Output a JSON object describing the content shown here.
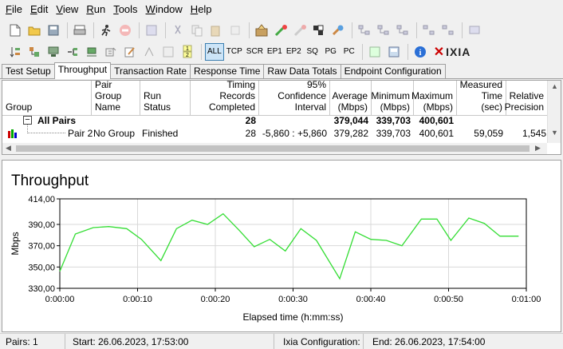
{
  "menu": [
    "File",
    "Edit",
    "View",
    "Run",
    "Tools",
    "Window",
    "Help"
  ],
  "menu_underline": [
    "F",
    "E",
    "V",
    "R",
    "T",
    "W",
    "H"
  ],
  "toolbar2_text_buttons": [
    "ALL",
    "TCP",
    "SCR",
    "EP1",
    "EP2",
    "SQ",
    "PG",
    "PC"
  ],
  "logo_text": "IXIA",
  "tabs": [
    "Test Setup",
    "Throughput",
    "Transaction Rate",
    "Response Time",
    "Raw Data Totals",
    "Endpoint Configuration"
  ],
  "active_tab": "Throughput",
  "grid": {
    "headers": {
      "group": "Group",
      "pair_group_name": "Pair Group Name",
      "run_status": "Run Status",
      "timing_records": "Timing Records Completed",
      "confidence": "95% Confidence Interval",
      "average": "Average (Mbps)",
      "minimum": "Minimum (Mbps)",
      "maximum": "Maximum (Mbps)",
      "measured_time": "Measured Time (sec)",
      "relative_precision": "Relative Precision"
    },
    "all_pairs": {
      "expander": "−",
      "label": "All Pairs",
      "timing_records": "28",
      "average": "379,044",
      "minimum": "339,703",
      "maximum": "400,601"
    },
    "pair_row": {
      "name": "Pair 2",
      "pair_group_name": "No Group",
      "run_status": "Finished",
      "timing_records": "28",
      "confidence": "-5,860 : +5,860",
      "average": "379,282",
      "minimum": "339,703",
      "maximum": "400,601",
      "measured_time": "59,059",
      "relative_precision": "1,545"
    }
  },
  "chart": {
    "title": "Throughput"
  },
  "chart_data": {
    "type": "line",
    "title": "Throughput",
    "xlabel": "Elapsed time (h:mm:ss)",
    "ylabel": "Mbps",
    "xlim": [
      0,
      60
    ],
    "ylim": [
      330,
      414
    ],
    "x_ticks": [
      "0:00:00",
      "0:00:10",
      "0:00:20",
      "0:00:30",
      "0:00:40",
      "0:00:50",
      "0:01:00"
    ],
    "y_ticks": [
      "330,00",
      "350,00",
      "370,00",
      "390,00",
      "414,00"
    ],
    "y_tick_values": [
      330,
      350,
      370,
      390,
      414
    ],
    "grid": true,
    "line_color": "#33dd33",
    "series": [
      {
        "x": [
          0,
          2,
          4.3,
          6.3,
          8.6,
          10.5,
          13,
          15,
          17,
          19,
          21,
          23,
          25,
          27,
          29,
          31,
          33,
          36,
          38,
          40,
          42,
          44,
          46.5,
          48.5,
          50.3,
          52.6,
          54.6,
          56.6,
          59
        ],
        "values": [
          346,
          381,
          387,
          388,
          386,
          376,
          356,
          386,
          394,
          390,
          400,
          385,
          369,
          376,
          365,
          386,
          375,
          339,
          383,
          376,
          375,
          370,
          395,
          395,
          375,
          396,
          391,
          379,
          379
        ]
      }
    ]
  },
  "status": {
    "pairs": "Pairs: 1",
    "start": "Start: 26.06.2023, 17:53:00",
    "ixia_config": "Ixia Configuration:",
    "end": "End: 26.06.2023, 17:54:00"
  }
}
